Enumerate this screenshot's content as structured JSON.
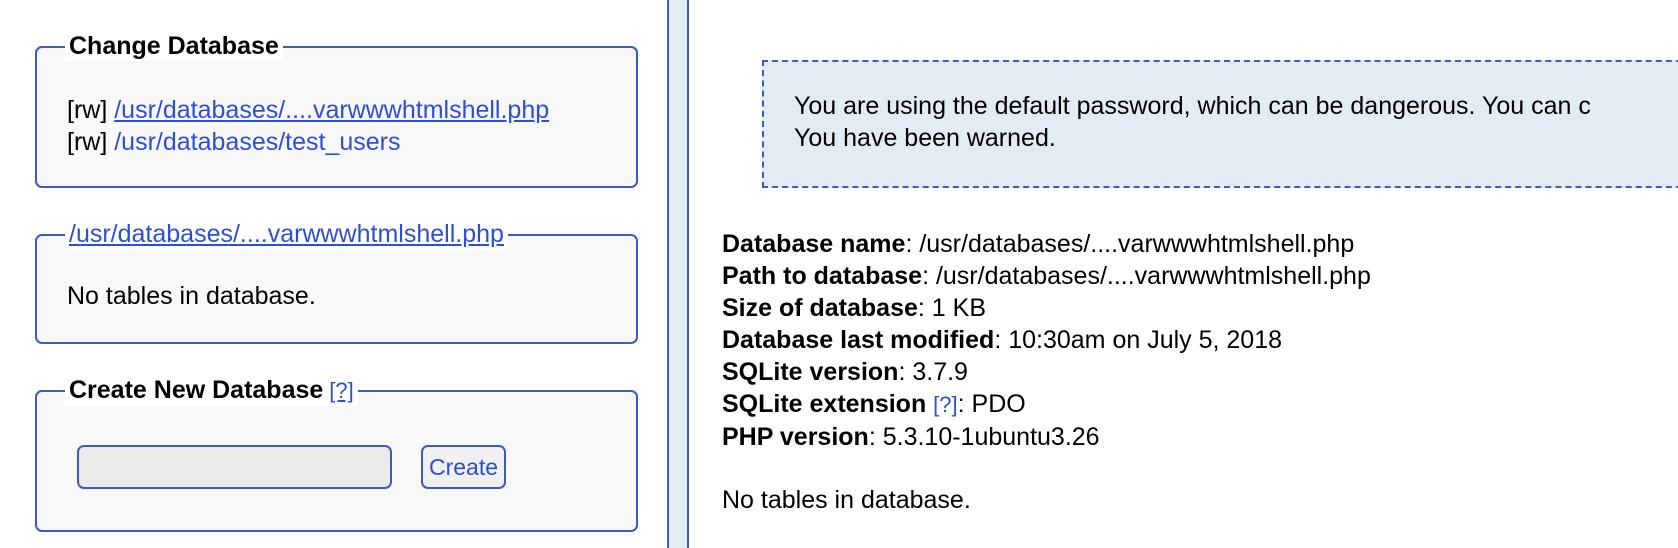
{
  "sidebar": {
    "change_database": {
      "legend": "Change Database",
      "databases": [
        {
          "mode": "[rw]",
          "path": "/usr/databases/....varwwwhtmlshell.php"
        },
        {
          "mode": "[rw]",
          "path": "/usr/databases/test_users"
        }
      ]
    },
    "current_database": {
      "legend": "/usr/databases/....varwwwhtmlshell.php",
      "message": "No tables in database."
    },
    "create_database": {
      "legend": "Create New Database",
      "help_link": "[?]",
      "input_value": "",
      "button_label": "Create"
    }
  },
  "main": {
    "warning": {
      "line1": "You are using the default password, which can be dangerous. You can c",
      "line2": "You have been warned."
    },
    "info": {
      "database_name": {
        "label": "Database name",
        "value": ": /usr/databases/....varwwwhtmlshell.php"
      },
      "path_to_database": {
        "label": "Path to database",
        "value": ": /usr/databases/....varwwwhtmlshell.php"
      },
      "size_of_database": {
        "label": "Size of database",
        "value": ": 1 KB"
      },
      "last_modified": {
        "label": "Database last modified",
        "value": ": 10:30am on July 5, 2018"
      },
      "sqlite_version": {
        "label": "SQLite version",
        "value": ": 3.7.9"
      },
      "sqlite_extension": {
        "label": "SQLite extension",
        "help_link": "[?]",
        "value": ": PDO"
      },
      "php_version": {
        "label": "PHP version",
        "value": ": 5.3.10-1ubuntu3.26"
      }
    },
    "no_tables": "No tables in database."
  }
}
